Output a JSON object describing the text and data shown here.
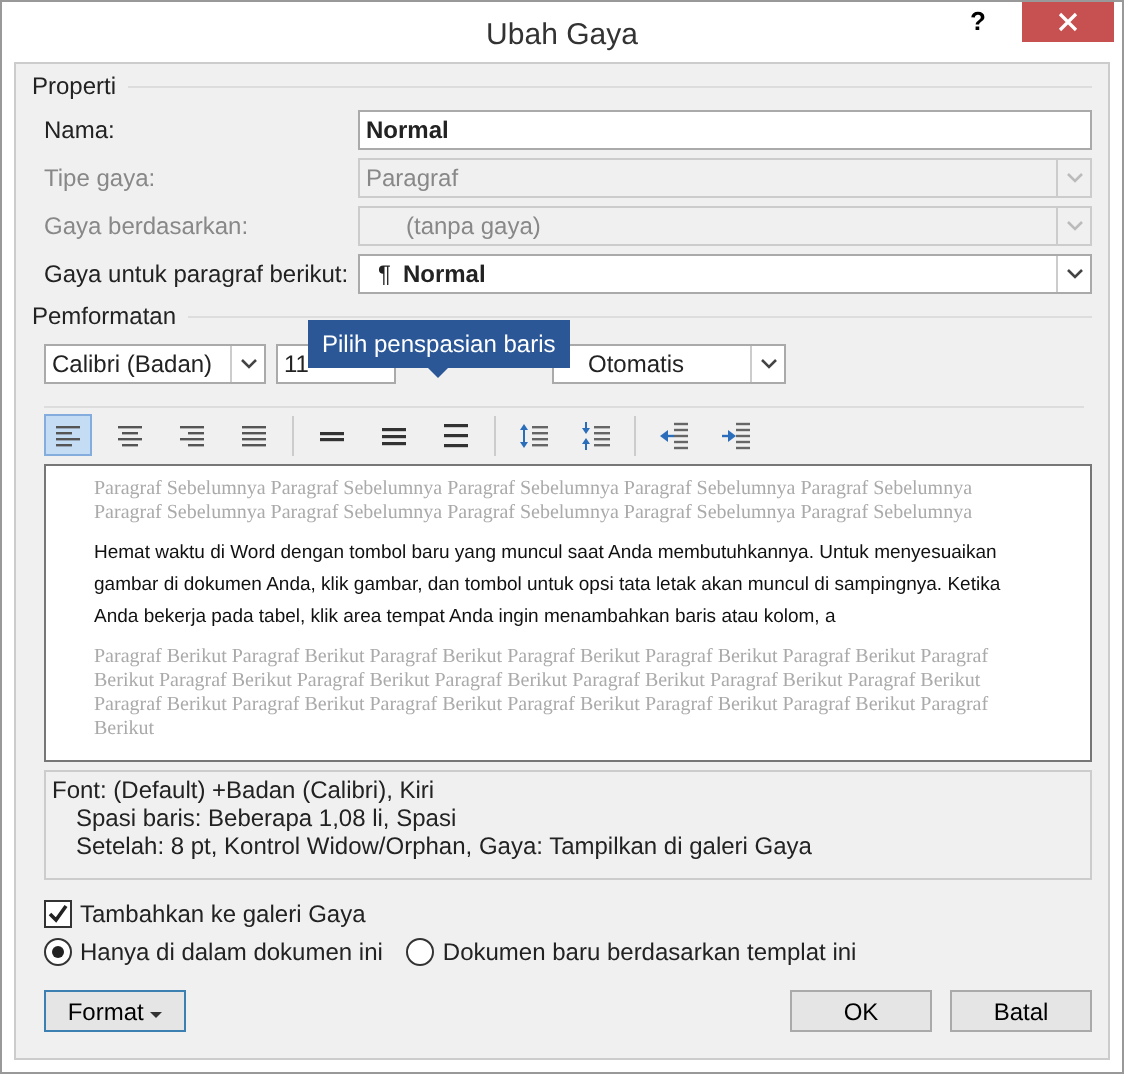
{
  "window": {
    "title": "Ubah Gaya",
    "help": "?"
  },
  "properti": {
    "heading": "Properti",
    "fields": [
      {
        "label": "Nama:",
        "kind": "text",
        "value": "Normal",
        "disabled": false
      },
      {
        "label": "Tipe gaya:",
        "kind": "select",
        "value": "Paragraf",
        "disabled": true
      },
      {
        "label": "Gaya berdasarkan:",
        "kind": "select",
        "value": "(tanpa gaya)",
        "disabled": true
      },
      {
        "label": "Gaya untuk paragraf berikut:",
        "kind": "select",
        "value": "Normal",
        "mark": "¶",
        "disabled": false
      }
    ]
  },
  "pemformatan": {
    "heading": "Pemformatan",
    "font": "Calibri (Badan)",
    "size": "11",
    "color_setting": "Otomatis",
    "tooltip": "Pilih penspasian baris",
    "toolbar": [
      {
        "kind": "align-left",
        "selected": true
      },
      {
        "kind": "align-center",
        "selected": false
      },
      {
        "kind": "align-right",
        "selected": false
      },
      {
        "kind": "justify",
        "selected": false
      },
      {
        "kind": "spacing-single",
        "selected": false
      },
      {
        "kind": "spacing-half",
        "selected": false
      },
      {
        "kind": "spacing-double",
        "selected": false
      },
      {
        "kind": "space-increase",
        "selected": false
      },
      {
        "kind": "space-decrease",
        "selected": false
      },
      {
        "kind": "indent-decrease",
        "selected": false
      },
      {
        "kind": "indent-increase",
        "selected": false
      }
    ]
  },
  "preview": {
    "previous": "Paragraf Sebelumnya Paragraf Sebelumnya Paragraf Sebelumnya Paragraf Sebelumnya Paragraf Sebelumnya Paragraf Sebelumnya Paragraf Sebelumnya Paragraf Sebelumnya Paragraf Sebelumnya Paragraf Sebelumnya",
    "sample": "Hemat waktu di Word dengan tombol baru yang muncul saat Anda membutuhkannya. Untuk menyesuaikan gambar di dokumen Anda, klik gambar, dan tombol untuk opsi tata letak akan muncul di sampingnya. Ketika Anda bekerja pada tabel, klik area tempat Anda ingin menambahkan baris atau kolom, a",
    "following": "Paragraf Berikut Paragraf Berikut Paragraf Berikut Paragraf Berikut Paragraf Berikut Paragraf Berikut Paragraf Berikut Paragraf Berikut Paragraf Berikut Paragraf Berikut Paragraf Berikut Paragraf Berikut Paragraf Berikut Paragraf Berikut Paragraf Berikut Paragraf Berikut Paragraf Berikut Paragraf Berikut Paragraf Berikut Paragraf Berikut"
  },
  "description": [
    "Font: (Default) +Badan (Calibri), Kiri",
    "Spasi baris:  Beberapa 1,08 li, Spasi",
    "Setelah:  8 pt, Kontrol Widow/Orphan, Gaya: Tampilkan di galeri Gaya"
  ],
  "add_to_gallery": {
    "label": "Tambahkan ke galeri Gaya",
    "checked": true
  },
  "scope": [
    {
      "label": "Hanya di dalam dokumen ini",
      "selected": true
    },
    {
      "label": "Dokumen baru berdasarkan templat ini",
      "selected": false
    }
  ],
  "buttons": {
    "format": "Format",
    "ok": "OK",
    "cancel": "Batal"
  }
}
